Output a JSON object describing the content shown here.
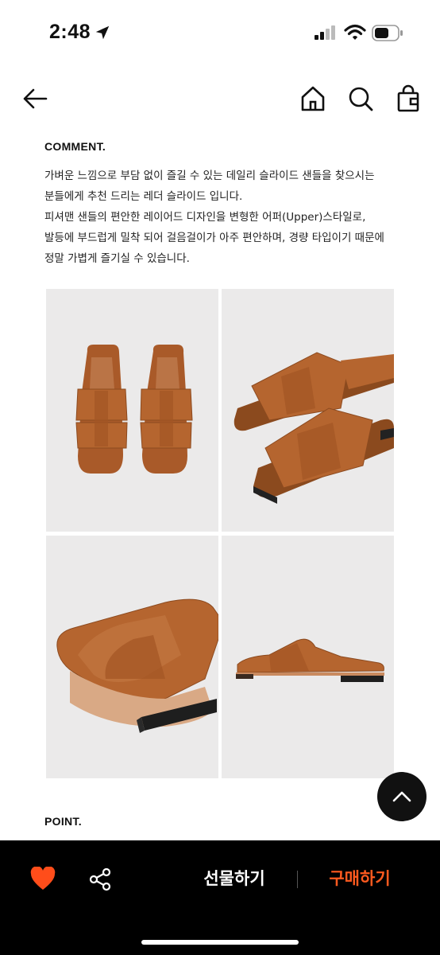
{
  "status_bar": {
    "time": "2:48"
  },
  "icons": {
    "back": "arrow-left-icon",
    "home": "home-icon",
    "search": "search-icon",
    "bag": "shopping-bag-icon",
    "scroll_top": "chevron-up-icon",
    "favorite": "heart-icon",
    "share": "share-icon"
  },
  "comment": {
    "heading": "COMMENT.",
    "text": "가벼운 느낌으로 부담 없이 즐길 수 있는 데일리 슬라이드 샌들을 찾으시는\n분들에게 추천 드리는 레더 슬라이드 입니다.\n피셔맨 샌들의 편안한 레이어드 디자인을 변형한 어퍼(Upper)스타일로,\n발등에 부드럽게 밀착 되어 걸음걸이가 아주 편안하며, 경량 타입이기 때문에\n정말 가볍게 즐기실 수 있습니다."
  },
  "point": {
    "heading": "POINT."
  },
  "bottom_bar": {
    "gift_label": "선물하기",
    "buy_label": "구매하기"
  },
  "colors": {
    "accent": "#ff5a1f",
    "heart": "#ff4d1a",
    "sandal": "#b5652f",
    "photo_bg": "#ebeaea"
  }
}
